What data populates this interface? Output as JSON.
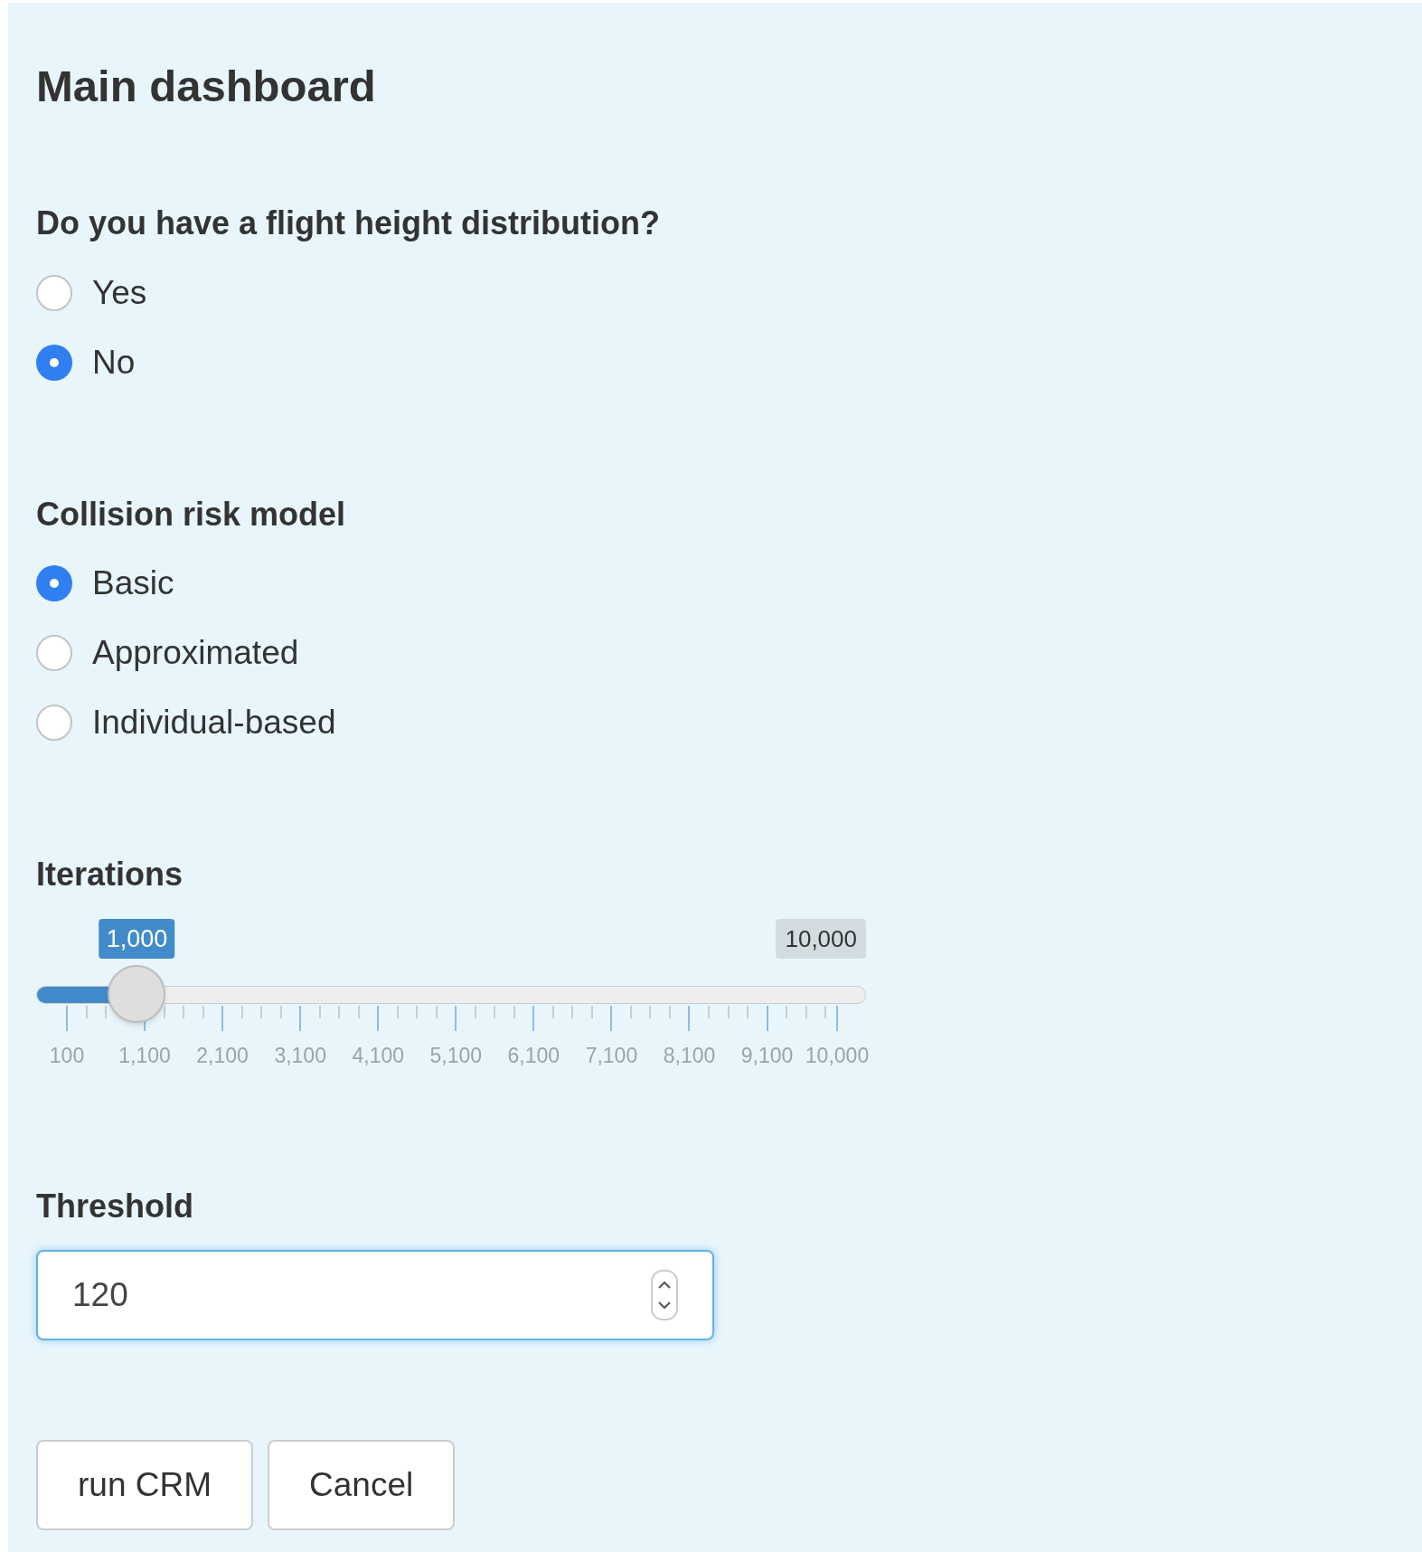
{
  "title": "Main dashboard",
  "flight_height": {
    "label": "Do you have a flight height distribution?",
    "options": [
      {
        "label": "Yes",
        "selected": false
      },
      {
        "label": "No",
        "selected": true
      }
    ]
  },
  "model": {
    "label": "Collision risk model",
    "options": [
      {
        "label": "Basic",
        "selected": true
      },
      {
        "label": "Approximated",
        "selected": false
      },
      {
        "label": "Individual-based",
        "selected": false
      }
    ]
  },
  "iterations": {
    "label": "Iterations",
    "value_label": "1,000",
    "max_label": "10,000",
    "level": 0.0909,
    "tick_labels": [
      "100",
      "1,100",
      "2,100",
      "3,100",
      "4,100",
      "5,100",
      "6,100",
      "7,100",
      "8,100",
      "9,100",
      "10,000"
    ]
  },
  "threshold": {
    "label": "Threshold",
    "value": "120"
  },
  "buttons": [
    "run CRM",
    "Cancel"
  ]
}
